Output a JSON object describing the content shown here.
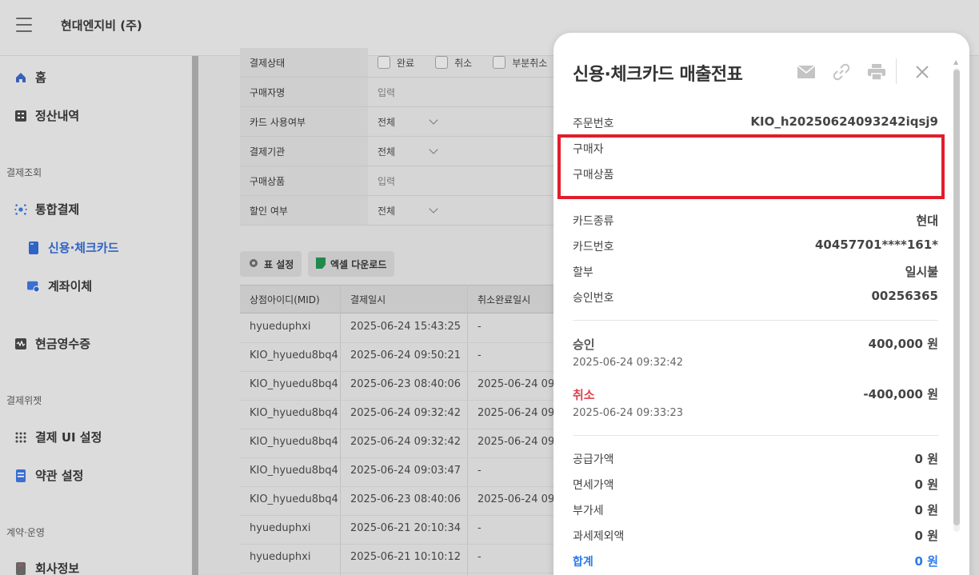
{
  "header": {
    "company": "현대엔지비 (주)"
  },
  "sidebar": {
    "home": "홈",
    "settlement": "정산내역",
    "section_payment": "결제조회",
    "integrated": "통합결제",
    "credit_card": "신용·체크카드",
    "account_transfer": "계좌이체",
    "cash_receipt": "현금영수증",
    "section_widget": "결제위젯",
    "payment_ui": "결제 UI 설정",
    "terms": "약관 설정",
    "section_contract": "계약·운영",
    "company_info": "회사정보"
  },
  "filters": {
    "status_label": "결제상태",
    "status_options": [
      "완료",
      "취소",
      "부분취소"
    ],
    "buyer_label": "구매자명",
    "buyer_placeholder": "입력",
    "card_use_label": "카드 사용여부",
    "card_use_value": "전체",
    "issuer_label": "결제기관",
    "issuer_value": "전체",
    "product_label": "구매상품",
    "product_placeholder": "입력",
    "discount_label": "할인 여부",
    "discount_value": "전체"
  },
  "toolbar": {
    "table_settings": "표 설정",
    "excel_download": "엑셀 다운로드"
  },
  "grid": {
    "columns": [
      "상점아이디(MID)",
      "결제일시",
      "취소완료일시"
    ],
    "rows": [
      [
        "hyueduphxi",
        "2025-06-24 15:43:25",
        "-"
      ],
      [
        "KIO_hyuedu8bq4",
        "2025-06-24 09:50:21",
        "-"
      ],
      [
        "KIO_hyuedu8bq4",
        "2025-06-23 08:40:06",
        "2025-06-24 09"
      ],
      [
        "KIO_hyuedu8bq4",
        "2025-06-24 09:32:42",
        "2025-06-24 09"
      ],
      [
        "KIO_hyuedu8bq4",
        "2025-06-24 09:32:42",
        "2025-06-24 09"
      ],
      [
        "KIO_hyuedu8bq4",
        "2025-06-24 09:03:47",
        "-"
      ],
      [
        "KIO_hyuedu8bq4",
        "2025-06-23 08:40:06",
        "2025-06-24 09"
      ],
      [
        "hyueduphxi",
        "2025-06-21 20:10:34",
        "-"
      ],
      [
        "hyueduphxi",
        "2025-06-21 10:10:12",
        "-"
      ]
    ]
  },
  "panel": {
    "title": "신용·체크카드 매출전표",
    "order_no_label": "주문번호",
    "order_no": "KIO_h20250624093242iqsj9",
    "buyer_label": "구매자",
    "product_label": "구매상품",
    "card_type_label": "카드종류",
    "card_type": "현대",
    "card_no_label": "카드번호",
    "card_no": "40457701****161*",
    "installment_label": "할부",
    "installment": "일시불",
    "approval_no_label": "승인번호",
    "approval_no": "00256365",
    "approve_label": "승인",
    "approve_amount": "400,000 원",
    "approve_time": "2025-06-24 09:32:42",
    "cancel_label": "취소",
    "cancel_amount": "-400,000 원",
    "cancel_time": "2025-06-24 09:33:23",
    "supply_label": "공급가액",
    "supply": "0 원",
    "taxfree_label": "면세가액",
    "taxfree": "0 원",
    "vat_label": "부가세",
    "vat": "0 원",
    "excluded_label": "과세제외액",
    "excluded": "0 원",
    "total_label": "합계",
    "total": "0 원"
  },
  "colors": {
    "accent": "#2f63c4",
    "cancel": "#e0424b",
    "highlight": "#e11d2b",
    "total": "#2b7bea"
  }
}
